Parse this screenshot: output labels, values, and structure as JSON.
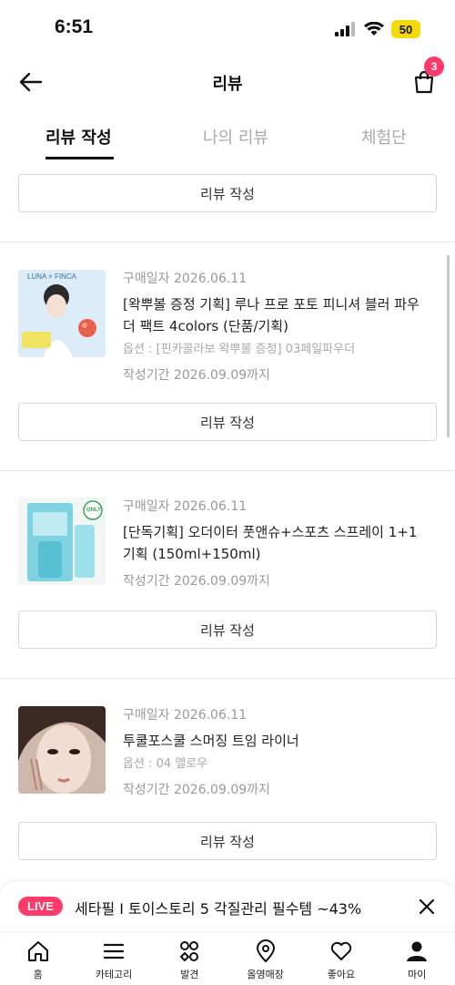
{
  "status": {
    "time": "6:51",
    "battery": "50"
  },
  "header": {
    "title": "리뷰",
    "cart_badge": "3"
  },
  "tabs": [
    {
      "label": "리뷰 작성"
    },
    {
      "label": "나의 리뷰"
    },
    {
      "label": "체험단"
    }
  ],
  "write_review_label": "리뷰 작성",
  "items": [
    {
      "purchase_date": "구매일자 2026.06.11",
      "name": "[왁뿌볼 증정 기획] 루나 프로 포토 피니셔 블러 파우더 팩트 4colors (단품/기획)",
      "option": "옵션 : [핀카콜라보 왁뿌볼 증정] 03페일파우더",
      "deadline": "작성기간 2026.09.09까지",
      "thumb_brand": "LUNA × FINCA"
    },
    {
      "purchase_date": "구매일자 2026.06.11",
      "name": "[단독기획] 오더이터 풋앤슈+스포츠 스프레이 1+1 기획 (150ml+150ml)",
      "option": "",
      "deadline": "작성기간 2026.09.09까지",
      "thumb_brand": "ONLY"
    },
    {
      "purchase_date": "구매일자 2026.06.11",
      "name": "투쿨포스쿨 스머징 트임 라이너",
      "option": "옵션 : 04 멜로우",
      "deadline": "작성기간 2026.09.09까지",
      "thumb_brand": ""
    }
  ],
  "promo": {
    "live_label": "LIVE",
    "text": "세타필 I 토이스토리 5 각질관리 필수템 ~43%"
  },
  "bottom_nav": [
    {
      "label": "홈",
      "icon": "home-icon"
    },
    {
      "label": "카테고리",
      "icon": "menu-icon"
    },
    {
      "label": "발견",
      "icon": "discover-icon"
    },
    {
      "label": "올영매장",
      "icon": "location-pin-icon"
    },
    {
      "label": "좋아요",
      "icon": "heart-icon"
    },
    {
      "label": "마이",
      "icon": "person-icon"
    }
  ],
  "colors": {
    "accent": "#ff3a6a",
    "battery": "#f5d90a"
  }
}
